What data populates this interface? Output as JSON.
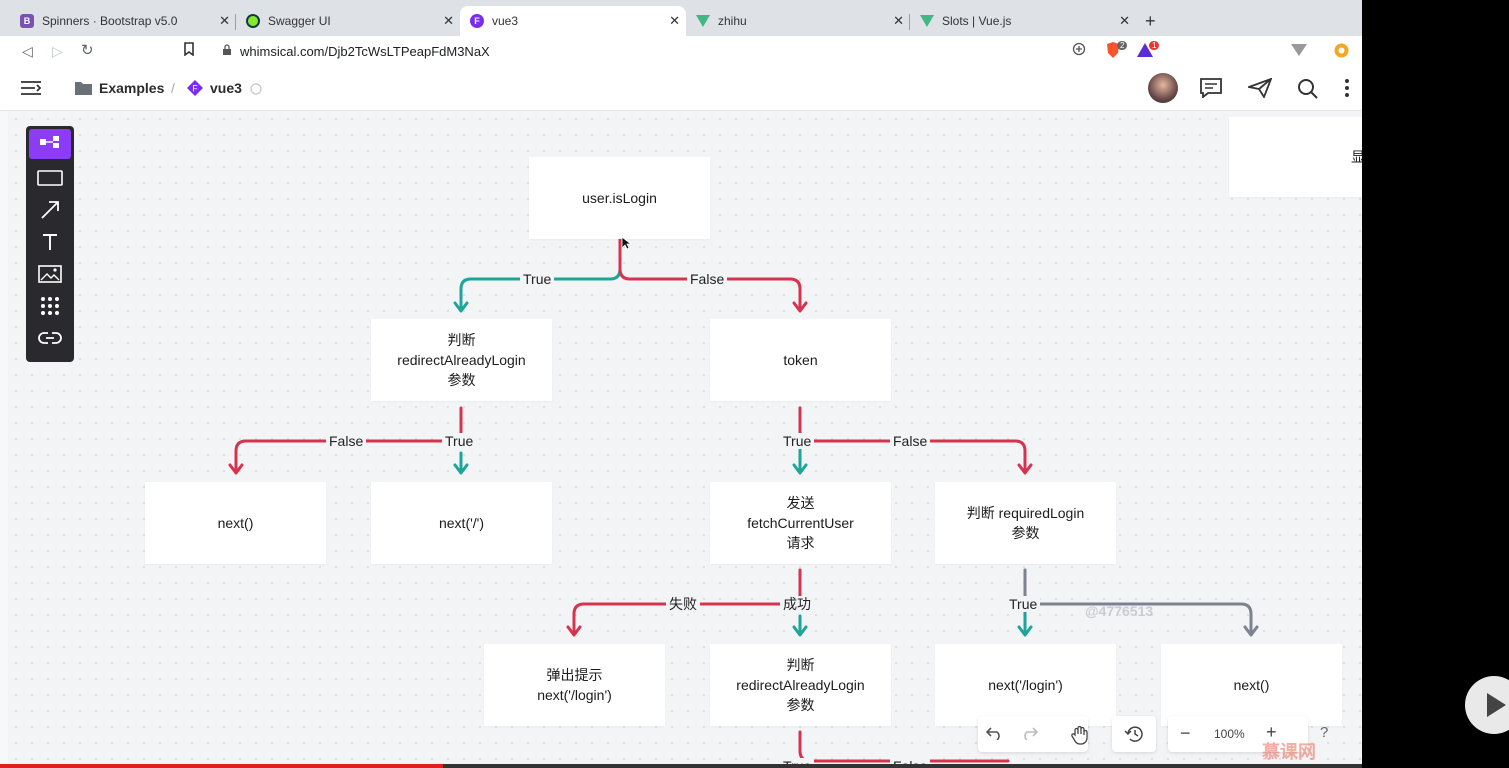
{
  "browser": {
    "tabs": [
      {
        "label": "Spinners · Bootstrap v5.0",
        "icon": "bootstrap-icon",
        "color": "#7952b3",
        "glyph": "B"
      },
      {
        "label": "Swagger UI",
        "icon": "swagger-icon",
        "color": "#85ea2d",
        "glyph": ""
      },
      {
        "label": "vue3",
        "icon": "whimsical-icon",
        "color": "#7b2cf1",
        "glyph": "F"
      },
      {
        "label": "zhihu",
        "icon": "vue-icon",
        "color": "#41b883",
        "glyph": ""
      },
      {
        "label": "Slots | Vue.js",
        "icon": "vue-icon",
        "color": "#41b883",
        "glyph": ""
      }
    ],
    "url": "whimsical.com/Djb2TcWsLTPeapFdM3NaX",
    "brave_badge": "2",
    "alert_badge": "1"
  },
  "app": {
    "breadcrumb_folder": "Examples",
    "breadcrumb_sep": "/",
    "breadcrumb_file": "vue3"
  },
  "flow": {
    "nodes": {
      "islogin": "user.isLogin",
      "judge_redirect": "判断\nredirectAlreadyLogin\n参数",
      "token": "token",
      "next1": "next()",
      "next_root": "next('/')",
      "fetch": "发送\nfetchCurrentUser\n请求",
      "judge_required": "判断 requiredLogin\n参数",
      "popup": "弹出提示\nnext('/login')",
      "judge_redirect2": "判断\nredirectAlreadyLogin\n参数",
      "next_login": "next('/login')",
      "next2": "next()",
      "partial_right": "显"
    },
    "labels": {
      "true1": "True",
      "false1": "False",
      "false2": "False",
      "true2": "True",
      "true3": "True",
      "false3": "False",
      "fail": "失败",
      "success": "成功",
      "true4": "True",
      "watermark": "@4776513",
      "true5": "True",
      "false5": "False"
    },
    "colors": {
      "true": "#1ea59a",
      "false": "#d6334f",
      "neutral": "#7d8290"
    }
  },
  "controls": {
    "zoom": "100%",
    "help": "?",
    "brand_watermark": "慕课网"
  }
}
